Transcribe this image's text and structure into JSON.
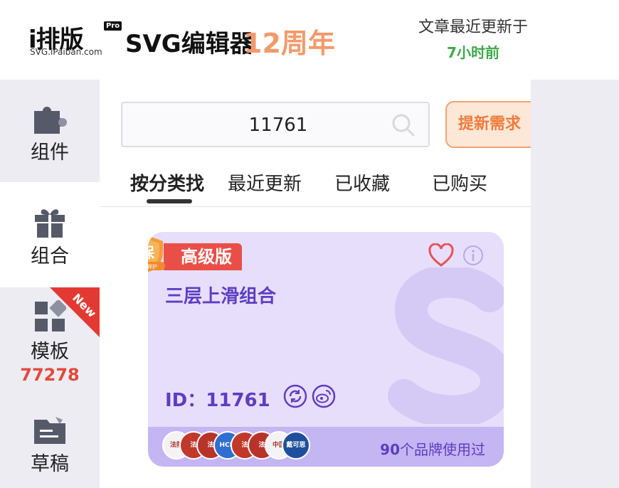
{
  "header": {
    "logo_brand": "i排版",
    "logo_pro": "Pro",
    "logo_domain": "SVG.iPaiban.com",
    "logo_product": "SVG编辑器",
    "logo_anniversary": "12周年",
    "update_label": "文章最近更新于",
    "update_time": "7小时前"
  },
  "sidebar": {
    "items": [
      {
        "label": "组件",
        "icon": "puzzle-icon"
      },
      {
        "label": "组合",
        "icon": "gift-icon"
      },
      {
        "label": "模板",
        "icon": "template-grid-icon",
        "count": "77278",
        "ribbon": "New"
      },
      {
        "label": "草稿",
        "icon": "draft-folder-icon"
      }
    ]
  },
  "search": {
    "value": "11761",
    "button": "提新需求"
  },
  "tabs": [
    {
      "label": "按分类找",
      "active": true
    },
    {
      "label": "最近更新",
      "active": false
    },
    {
      "label": "已收藏",
      "active": false
    },
    {
      "label": "已购买",
      "active": false
    }
  ],
  "card": {
    "badge": "高级版",
    "shield_text": "保",
    "shield_caption": "版权保护",
    "title": "三层上滑组合",
    "id_text": "ID：11761",
    "brands_count": "90",
    "brands_suffix": "个品牌使用过",
    "brand_logos": [
      {
        "text": "法院",
        "color": "#f3f3f3"
      },
      {
        "text": "法",
        "color": "#c0392b"
      },
      {
        "text": "法",
        "color": "#b8332a"
      },
      {
        "text": "HCM",
        "color": "#2e6fd1"
      },
      {
        "text": "法",
        "color": "#c0392b"
      },
      {
        "text": "法",
        "color": "#b8332a"
      },
      {
        "text": "中国",
        "color": "#f3f3f3"
      },
      {
        "text": "戴可思",
        "color": "#1e4f9c"
      }
    ]
  },
  "colors": {
    "accent_purple": "#5b3fbf",
    "premium_red": "#ea4f47",
    "anniversary_orange": "#f39a6b",
    "update_green": "#3ea94a",
    "count_red": "#e24a3c"
  }
}
